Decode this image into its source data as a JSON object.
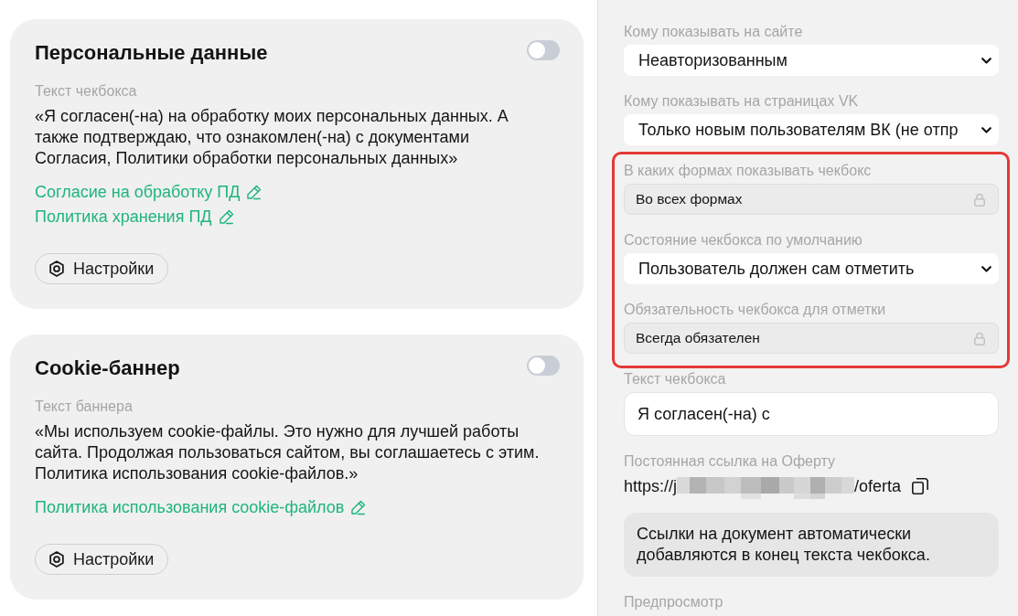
{
  "cards": [
    {
      "title": "Персональные данные",
      "toggle": {
        "on": false
      },
      "text_label": "Текст чекбокса",
      "text": "«Я согласен(-на) на обработку моих персональных данных. А также подтверждаю, что ознакомлен(-на) с документами Согласия, Политики обработки персональных данных»",
      "links": [
        "Согласие на обработку ПД",
        "Политика хранения ПД"
      ],
      "settings_button": "Настройки"
    },
    {
      "title": "Cookie-баннер",
      "toggle": {
        "on": false
      },
      "text_label": "Текст баннера",
      "text": "«Мы используем cookie-файлы. Это нужно для лучшей работы сайта. Продолжая пользоваться сайтом, вы соглашаетесь с этим. Политика использования cookie-файлов.»",
      "links": [
        "Политика использования cookie-файлов"
      ],
      "settings_button": "Настройки"
    }
  ],
  "settings_panel": {
    "sections": [
      {
        "highlighted": false,
        "fields": [
          {
            "kind": "select",
            "label": "Кому показывать на сайте",
            "value": "Неавторизованным"
          },
          {
            "kind": "select",
            "label": "Кому показывать на страницах VK",
            "value": "Только новым пользователям ВК (не отпр"
          }
        ]
      },
      {
        "highlighted": true,
        "fields": [
          {
            "kind": "locked",
            "label": "В каких формах показывать чекбокс",
            "value": "Во всех формах"
          },
          {
            "kind": "select",
            "label": "Состояние чекбокса по умолчанию",
            "value": "Пользователь должен сам отметить"
          },
          {
            "kind": "locked",
            "label": "Обязательность чекбокса для отметки",
            "value": "Всегда обязателен"
          }
        ]
      },
      {
        "highlighted": false,
        "fields": [
          {
            "kind": "input",
            "label": "Текст чекбокса",
            "value": "Я согласен(-на) с"
          },
          {
            "kind": "link",
            "label": "Постоянная ссылка на Оферту",
            "url_start": "https://j",
            "redacted": true,
            "url_end": "/oferta"
          },
          {
            "kind": "note",
            "text": "Ссылки на документ автоматически добавляются в конец текста чекбокса."
          }
        ]
      }
    ],
    "preview_label": "Предпросмотр"
  }
}
